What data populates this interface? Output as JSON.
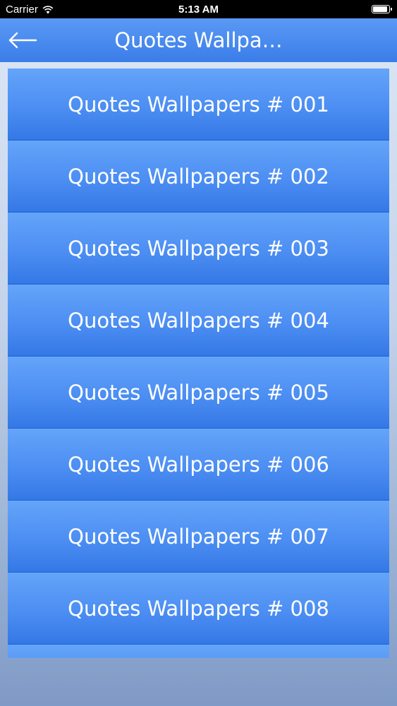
{
  "status_bar": {
    "carrier": "Carrier",
    "time": "5:13 AM"
  },
  "nav": {
    "title": "Quotes Wallpa…",
    "back_icon": "arrow-left-icon"
  },
  "list": {
    "items": [
      {
        "label": "Quotes Wallpapers # 001"
      },
      {
        "label": "Quotes Wallpapers # 002"
      },
      {
        "label": "Quotes Wallpapers # 003"
      },
      {
        "label": "Quotes Wallpapers # 004"
      },
      {
        "label": "Quotes Wallpapers # 005"
      },
      {
        "label": "Quotes Wallpapers # 006"
      },
      {
        "label": "Quotes Wallpapers # 007"
      },
      {
        "label": "Quotes Wallpapers # 008"
      },
      {
        "label": ""
      }
    ]
  },
  "colors": {
    "accent": "#4a8cf2",
    "nav_bar": "#4a8cf2",
    "status_bar": "#000000"
  }
}
